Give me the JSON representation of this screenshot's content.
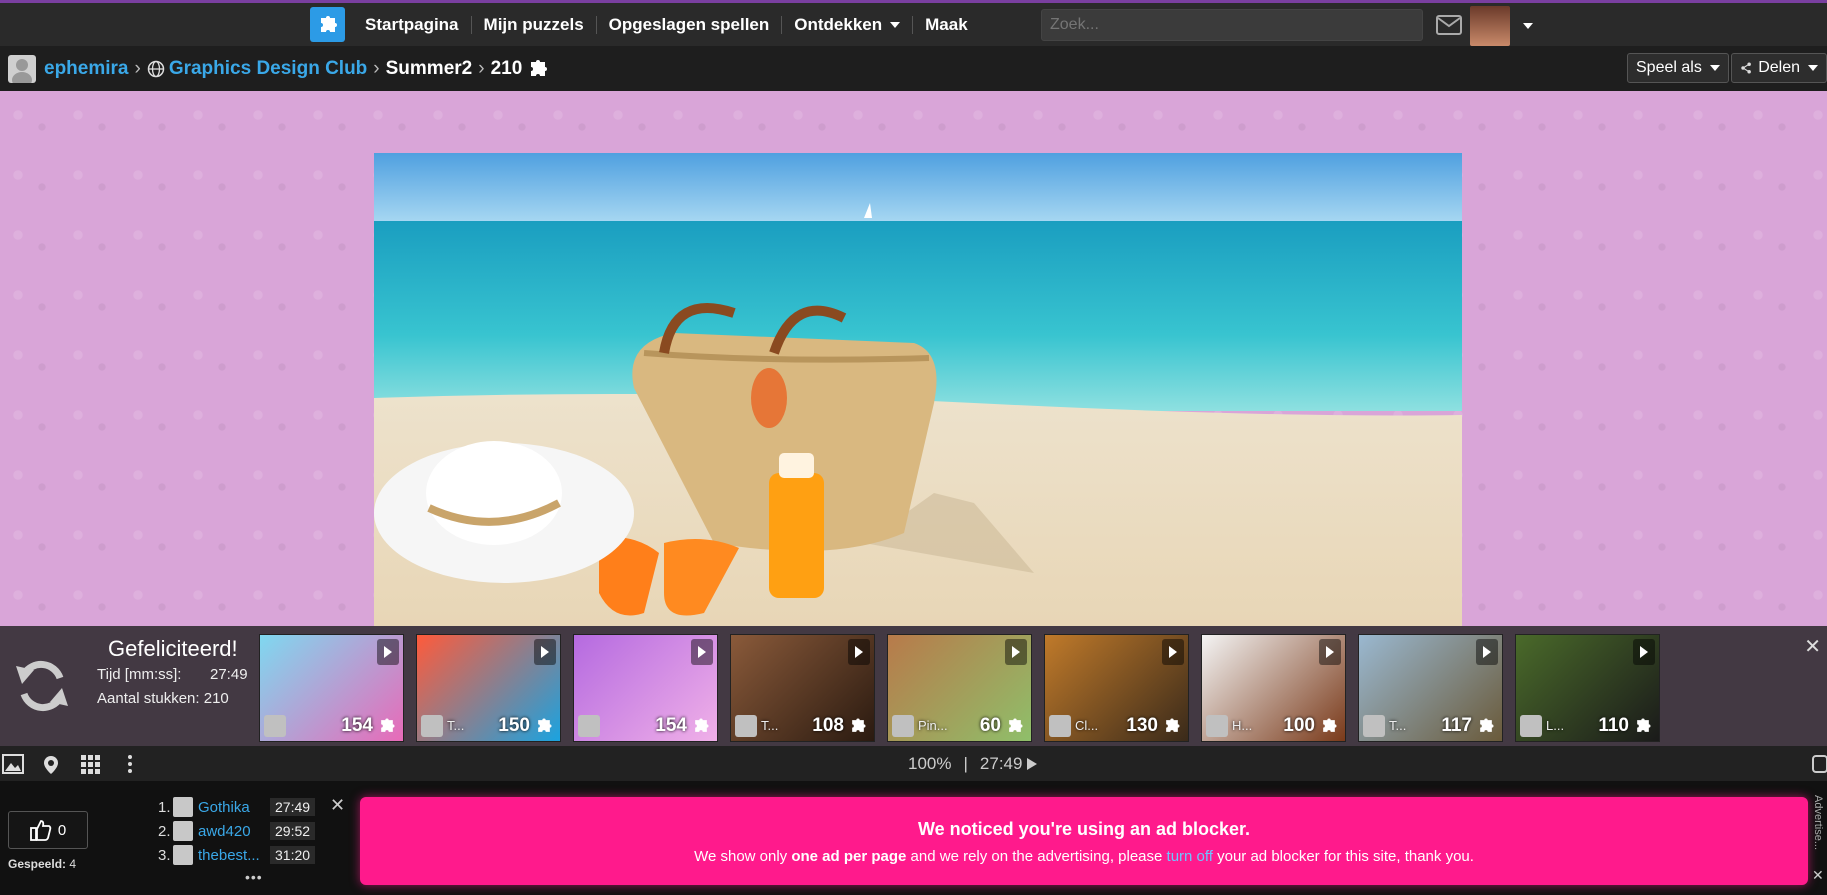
{
  "nav": {
    "items": [
      "Startpagina",
      "Mijn puzzels",
      "Opgeslagen spellen",
      "Ontdekken",
      "Maak"
    ],
    "search_placeholder": "Zoek..."
  },
  "breadcrumb": {
    "user": "ephemira",
    "group": "Graphics Design Club",
    "album": "Summer2",
    "pieces": "210"
  },
  "actions": {
    "play_as": "Speel als",
    "share": "Delen"
  },
  "result": {
    "title": "Gefeliciteerd!",
    "time_label": "Tijd [mm:ss]:",
    "time_value": "27:49",
    "pieces_label": "Aantal stukken: 210"
  },
  "thumbnails": [
    {
      "count": "154",
      "name": "",
      "c1": "#7fd8f0",
      "c2": "#e86ab8"
    },
    {
      "count": "150",
      "name": "T...",
      "c1": "#ff5a3a",
      "c2": "#1aa3e0"
    },
    {
      "count": "154",
      "name": "",
      "c1": "#b56ae0",
      "c2": "#f0b0e8"
    },
    {
      "count": "108",
      "name": "T...",
      "c1": "#8a5a3a",
      "c2": "#2a1a10"
    },
    {
      "count": "60",
      "name": "Pin...",
      "c1": "#b87a4a",
      "c2": "#8fbf6a"
    },
    {
      "count": "130",
      "name": "Cl...",
      "c1": "#c07a2a",
      "c2": "#3a2a1a"
    },
    {
      "count": "100",
      "name": "H...",
      "c1": "#f4f4f4",
      "c2": "#7a3a1a"
    },
    {
      "count": "117",
      "name": "T...",
      "c1": "#9ab8d0",
      "c2": "#6a5a3a"
    },
    {
      "count": "110",
      "name": "L...",
      "c1": "#4a6a2a",
      "c2": "#1a1a1a"
    }
  ],
  "toolbar": {
    "zoom": "100%",
    "divider": "|",
    "timer": "27:49"
  },
  "footer": {
    "likes": "0",
    "played_label": "Gespeeld:",
    "played_value": "4",
    "scores": [
      {
        "rank": "1.",
        "name": "Gothika",
        "time": "27:49"
      },
      {
        "rank": "2.",
        "name": "awd420",
        "time": "29:52"
      },
      {
        "rank": "3.",
        "name": "thebest...",
        "time": "31:20"
      }
    ],
    "more": "•••"
  },
  "ad": {
    "heading": "We noticed you're using an ad blocker.",
    "text_a": "We show only ",
    "text_bold": "one ad per page",
    "text_b": " and we rely on the advertising, please ",
    "link": "turn off",
    "text_c": " your ad blocker for this site, thank you.",
    "side_label": "Advertise..."
  }
}
